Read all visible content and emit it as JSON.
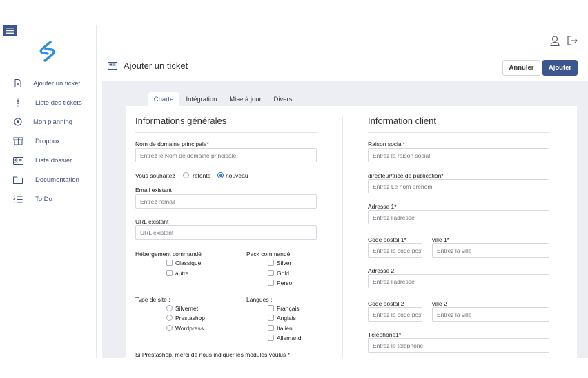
{
  "sidebar": {
    "items": [
      {
        "label": "Ajouter un ticket",
        "icon": "file-plus-icon"
      },
      {
        "label": "Liste des tickets",
        "icon": "list-dots-icon"
      },
      {
        "label": "Mon planning",
        "icon": "target-icon"
      },
      {
        "label": "Dropbox",
        "icon": "box-icon"
      },
      {
        "label": "Liste dossier",
        "icon": "id-card-icon"
      },
      {
        "label": "Documentation",
        "icon": "folder-icon"
      },
      {
        "label": "To Do",
        "icon": "checklist-icon"
      }
    ]
  },
  "header": {
    "title": "Ajouter un ticket",
    "cancel_label": "Annuler",
    "add_label": "Ajouter"
  },
  "tabs": [
    "Charte",
    "Intégration",
    "Mise à jour",
    "Divers"
  ],
  "general": {
    "title": "Informations générales",
    "domain_label": "Nom de domaine principale*",
    "domain_placeholder": "Entrez le Nom de domaine principale",
    "wish_label": "Vous souhaitez",
    "wish_opt1": "refonte",
    "wish_opt2": "nouveau",
    "email_label": "Email existant",
    "email_placeholder": "Entrez l'email",
    "url_label": "URL existant",
    "url_placeholder": "URL existant",
    "hosting_label": "Hébergement commandé",
    "hosting_opts": [
      "Classique",
      "autre"
    ],
    "pack_label": "Pack commandé",
    "pack_opts": [
      "Silver",
      "Gold",
      "Perso"
    ],
    "site_type_label": "Type de site :",
    "site_type_opts": [
      "Silvernet",
      "Prestashop",
      "Wordpress"
    ],
    "lang_label": "Langues :",
    "lang_opts": [
      "Français",
      "Anglais",
      "Italien",
      "Allemand"
    ],
    "presta_note": "Si Prestashop, merci de nous indiquer les modules voulus *"
  },
  "client": {
    "title": "Information client",
    "company_label": "Raison social*",
    "company_placeholder": "Entrez la raison social",
    "director_label": "directeur/trice de publication*",
    "director_placeholder": "Entrez Le nom prénom",
    "address1_label": "Adresse 1*",
    "address1_placeholder": "Entrez l'adresse",
    "zip1_label": "Code postal 1*",
    "zip1_placeholder": "Entrez le code postal",
    "city1_label": "ville 1*",
    "city1_placeholder": "Entrez la ville",
    "address2_label": "Adresse 2",
    "address2_placeholder": "Entrez l'adresse",
    "zip2_label": "Code postal 2",
    "zip2_placeholder": "Entrez le code postal",
    "city2_label": "ville 2",
    "city2_placeholder": "Entrez la ville",
    "phone_label": "Téléphone1*",
    "phone_placeholder": "Entrez le téléphone"
  },
  "colors": {
    "accent": "#3e568f",
    "logo": "#2f8fd8",
    "background": "#eceef3"
  }
}
